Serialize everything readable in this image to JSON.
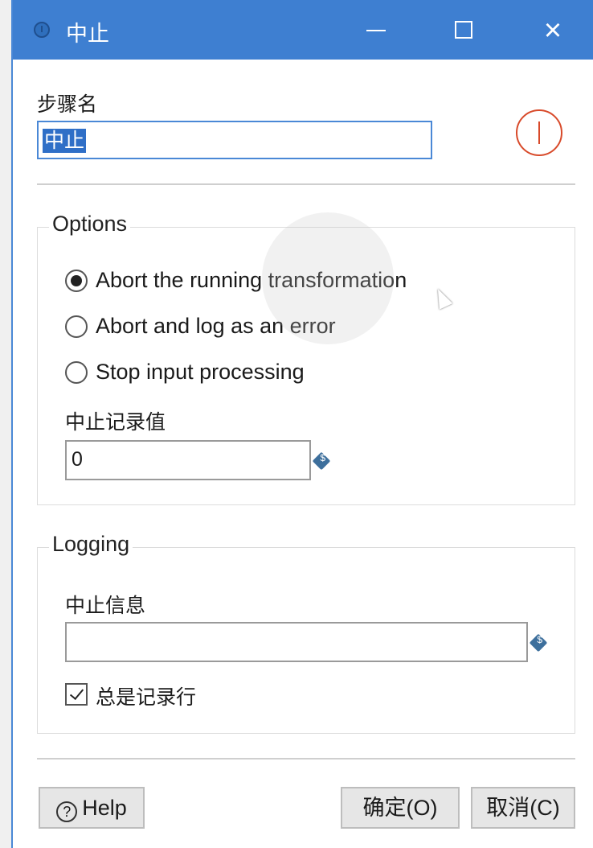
{
  "window": {
    "title": "中止",
    "minimize_label": "−",
    "maximize_label": "□",
    "close_label": "×"
  },
  "step_name": {
    "label": "步骤名",
    "value": "中止"
  },
  "options": {
    "title": "Options",
    "radio_options": [
      {
        "label": "Abort the running transformation",
        "checked": true
      },
      {
        "label": "Abort and log as an error",
        "checked": false
      },
      {
        "label": "Stop input processing",
        "checked": false
      }
    ],
    "abort_threshold_label": "中止记录值",
    "abort_threshold_value": "0"
  },
  "logging": {
    "title": "Logging",
    "message_label": "中止信息",
    "message_value": "",
    "always_log_rows_label": "总是记录行",
    "always_log_rows_checked": true
  },
  "buttons": {
    "help": "Help",
    "ok": "确定(O)",
    "cancel": "取消(C)"
  },
  "icons": {
    "title_icon": "info-circle-icon",
    "abort_icon": "abort-icon",
    "variable_icon": "variable-icon",
    "help_icon": "question-icon"
  },
  "colors": {
    "titlebar": "#3e7fd1",
    "selection": "#2f6fc7",
    "abort_icon": "#d84a2a"
  }
}
